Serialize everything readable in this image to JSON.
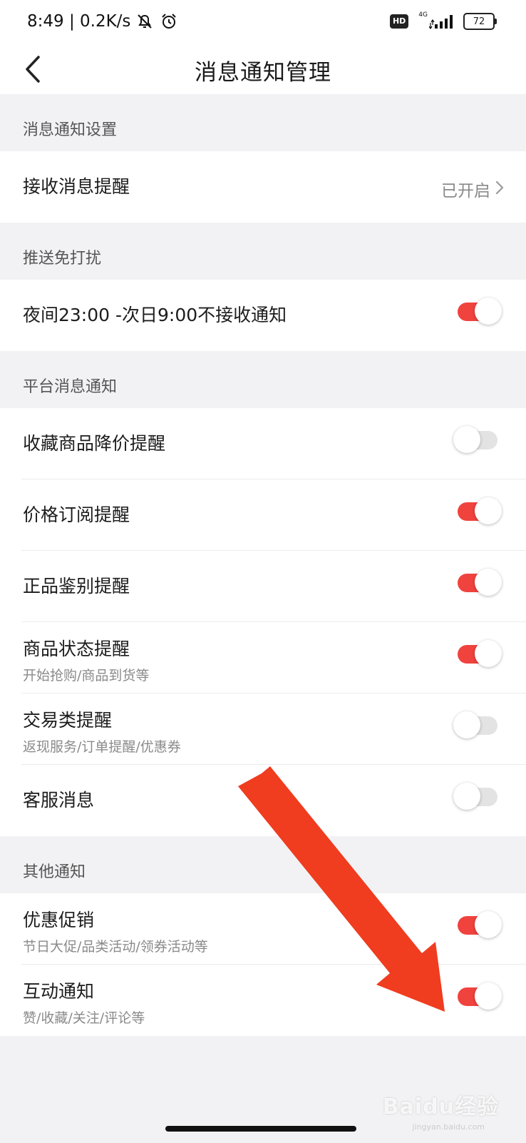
{
  "status_bar": {
    "time_speed": "8:49 | 0.2K/s",
    "hd_label": "HD",
    "network_label": "4G",
    "battery": "72"
  },
  "header": {
    "title": "消息通知管理"
  },
  "sections": {
    "s1": {
      "header": "消息通知设置",
      "receive": {
        "title": "接收消息提醒",
        "value": "已开启"
      }
    },
    "s2": {
      "header": "推送免打扰",
      "night": {
        "title": "夜间23:00 -次日9:00不接收通知",
        "enabled": true
      }
    },
    "s3": {
      "header": "平台消息通知",
      "collect_price_drop": {
        "title": "收藏商品降价提醒",
        "enabled": false
      },
      "price_subscribe": {
        "title": "价格订阅提醒",
        "enabled": true
      },
      "authentic": {
        "title": "正品鉴别提醒",
        "enabled": true
      },
      "product_status": {
        "title": "商品状态提醒",
        "subtitle": "开始抢购/商品到货等",
        "enabled": true
      },
      "trade": {
        "title": "交易类提醒",
        "subtitle": "返现服务/订单提醒/优惠券",
        "enabled": false
      },
      "customer_service": {
        "title": "客服消息",
        "enabled": false
      }
    },
    "s4": {
      "header": "其他通知",
      "promotion": {
        "title": "优惠促销",
        "subtitle": "节日大促/品类活动/领券活动等",
        "enabled": true
      },
      "interaction": {
        "title": "互动通知",
        "subtitle": "赞/收藏/关注/评论等",
        "enabled": true
      }
    }
  },
  "overlay": {
    "arrow_color": "#f03c1f"
  },
  "watermark": {
    "logo_text": "Baidu经验",
    "url": "jingyan.baidu.com"
  },
  "colors": {
    "toggle_on": "#f0433e",
    "toggle_off": "#e3e3e3",
    "background": "#f2f2f4"
  }
}
